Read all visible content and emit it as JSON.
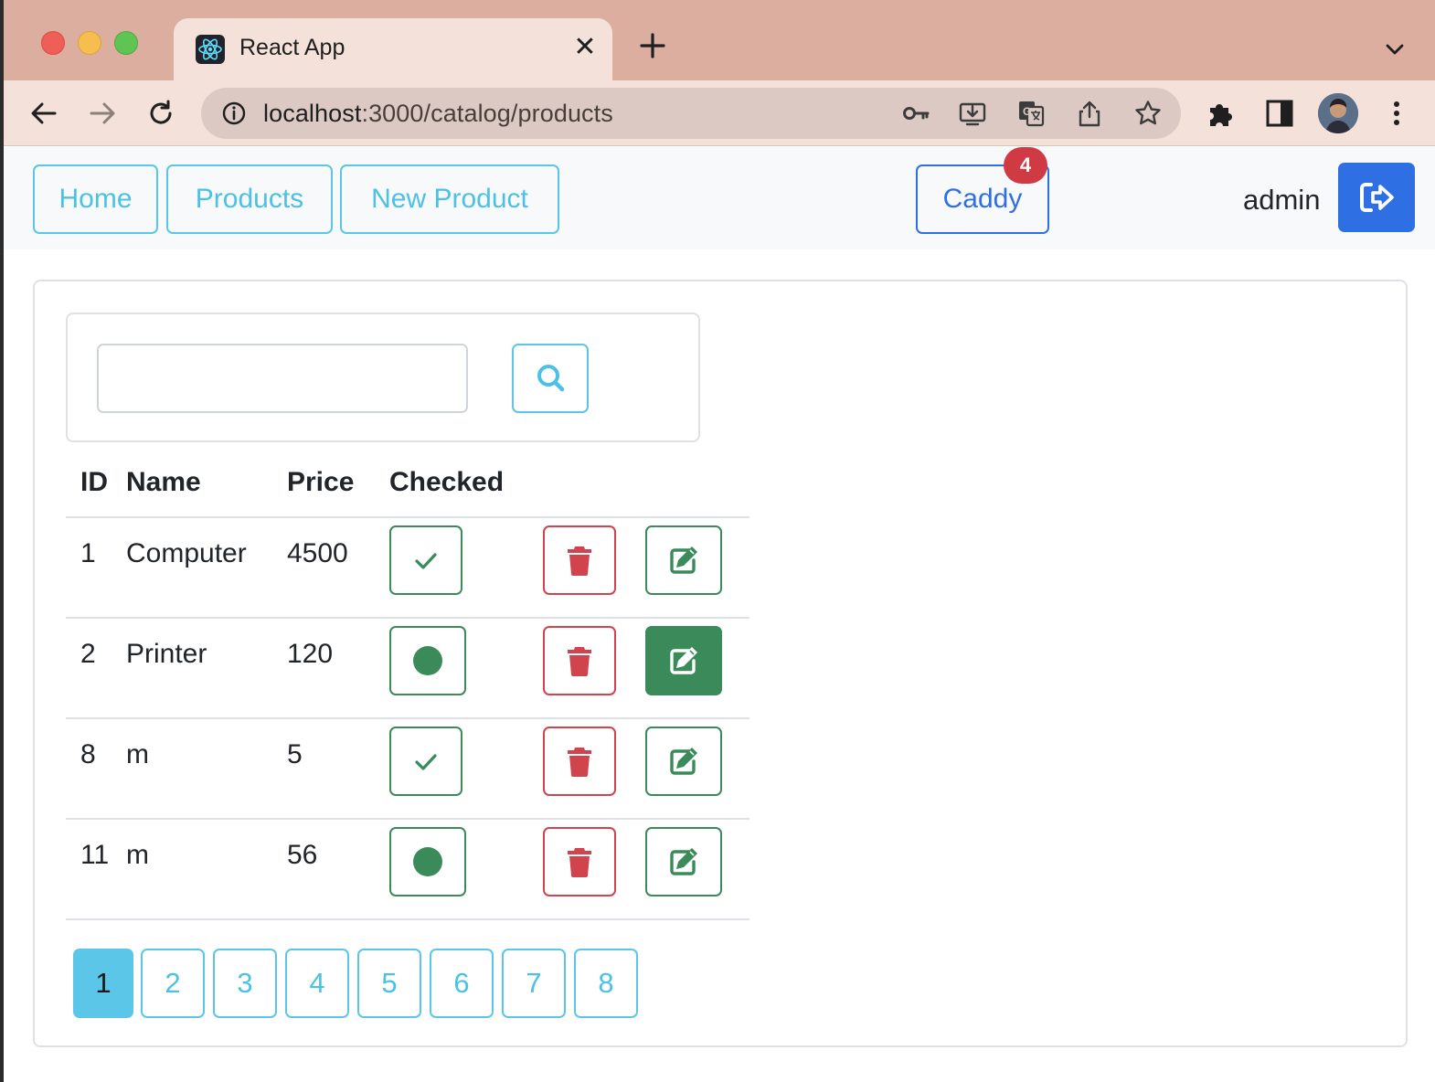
{
  "browser": {
    "tab_title": "React App",
    "tab_close": "✕",
    "url_host": "localhost",
    "url_path": ":3000/catalog/products"
  },
  "navbar": {
    "home_label": "Home",
    "products_label": "Products",
    "new_product_label": "New Product",
    "caddy_label": "Caddy",
    "caddy_count": "4",
    "username": "admin"
  },
  "search": {
    "value": "",
    "placeholder": ""
  },
  "table": {
    "headers": {
      "id": "ID",
      "name": "Name",
      "price": "Price",
      "checked": "Checked"
    },
    "rows": [
      {
        "id": "1",
        "name": "Computer",
        "price": "4500",
        "checked": true,
        "edit_active": false
      },
      {
        "id": "2",
        "name": "Printer",
        "price": "120",
        "checked": false,
        "edit_active": true
      },
      {
        "id": "8",
        "name": "m",
        "price": "5",
        "checked": true,
        "edit_active": false
      },
      {
        "id": "11",
        "name": "m",
        "price": "56",
        "checked": false,
        "edit_active": false
      }
    ]
  },
  "pagination": {
    "pages": [
      "1",
      "2",
      "3",
      "4",
      "5",
      "6",
      "7",
      "8"
    ],
    "current": "1"
  },
  "colors": {
    "info": "#5bc6e8",
    "primary": "#2f6fe4",
    "success": "#3a8a5a",
    "danger": "#d2444d",
    "badge": "#d03a43"
  }
}
